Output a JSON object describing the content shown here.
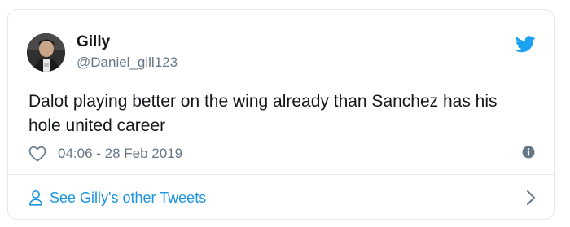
{
  "tweet": {
    "display_name": "Gilly",
    "handle": "@Daniel_gill123",
    "text": "Dalot playing better on the wing already than Sanchez has his hole united career",
    "timestamp": "04:06 - 28 Feb 2019"
  },
  "footer": {
    "label": "See Gilly's other Tweets"
  },
  "icons": {
    "brand": "twitter-bird-icon",
    "like": "heart-outline-icon",
    "info": "info-icon",
    "profile": "person-icon",
    "next": "chevron-right-icon"
  },
  "colors": {
    "brand_blue": "#1da1f2",
    "link_blue": "#1b95e0",
    "secondary_text": "#657786",
    "border": "#e1e8ed"
  }
}
